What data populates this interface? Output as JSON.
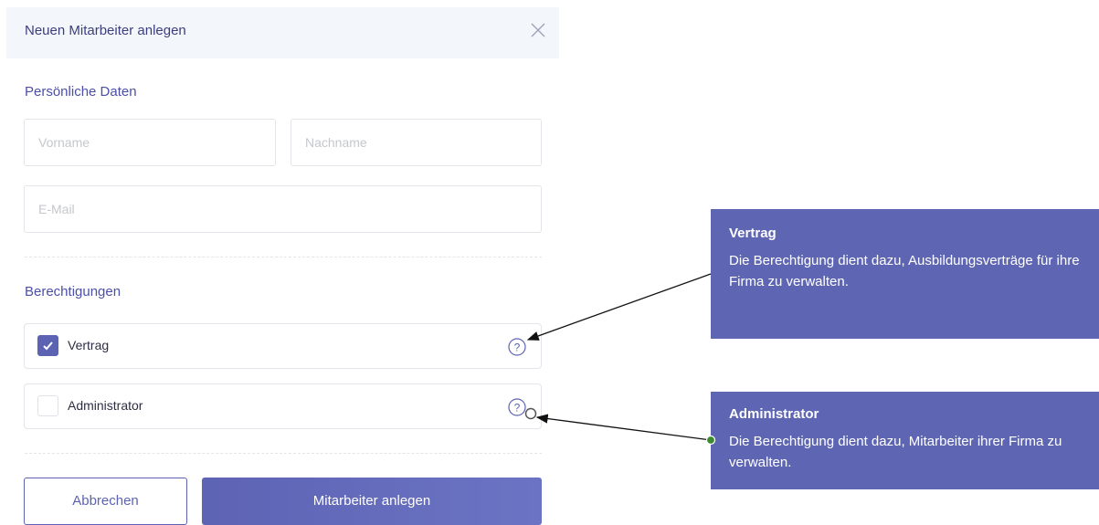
{
  "modal": {
    "title": "Neuen Mitarbeiter anlegen",
    "close_icon": "close-icon"
  },
  "personal": {
    "heading": "Persönliche Daten",
    "first_name": {
      "value": "",
      "placeholder": "Vorname"
    },
    "last_name": {
      "value": "",
      "placeholder": "Nachname"
    },
    "email": {
      "value": "",
      "placeholder": "E-Mail"
    }
  },
  "permissions": {
    "heading": "Berechtigungen",
    "items": [
      {
        "label": "Vertrag",
        "checked": true,
        "help_icon": "question-circle-icon"
      },
      {
        "label": "Administrator",
        "checked": false,
        "help_icon": "question-circle-icon"
      }
    ]
  },
  "actions": {
    "cancel_label": "Abbrechen",
    "submit_label": "Mitarbeiter anlegen"
  },
  "tooltips": [
    {
      "title": "Vertrag",
      "text": "Die Berechtigung dient dazu, Ausbildungsverträge für ihre Firma zu verwalten."
    },
    {
      "title": "Administrator",
      "text": "Die Berechtigung dient dazu, Mitarbeiter ihrer Firma zu verwalten."
    }
  ],
  "colors": {
    "accent": "#5c63b3",
    "tooltip_bg": "#5e66b4",
    "header_bg": "#f3f7fc",
    "connector_dot": "#3d8b2f"
  }
}
